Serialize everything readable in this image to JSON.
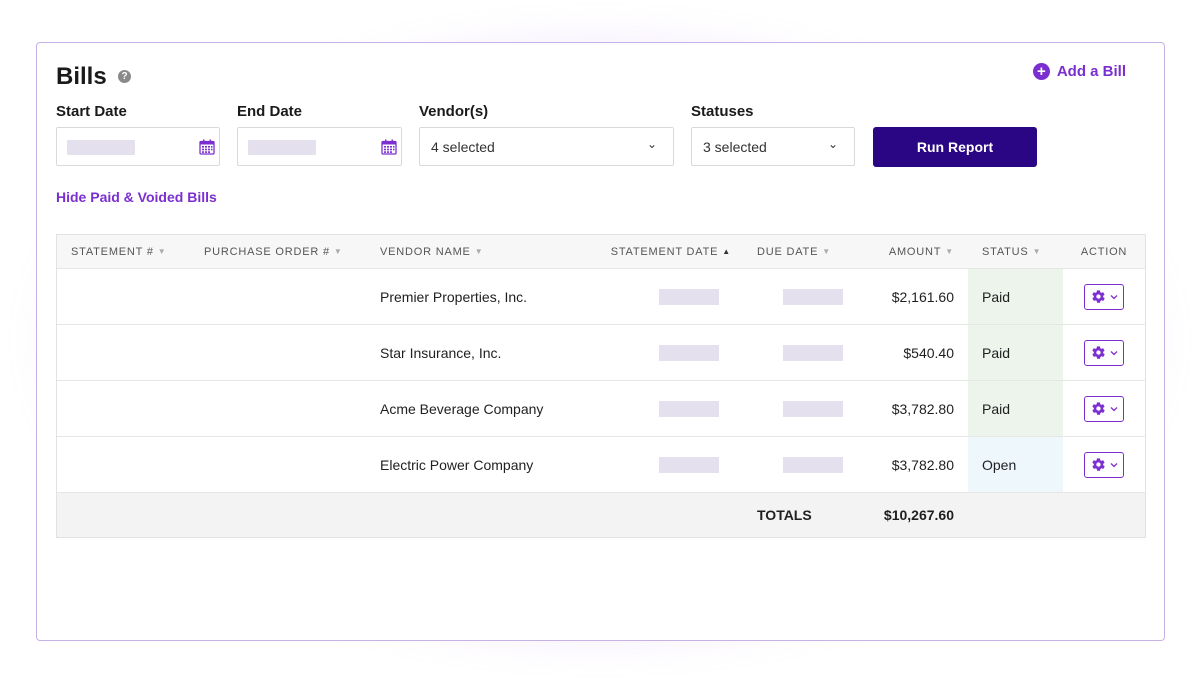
{
  "page": {
    "title": "Bills",
    "help_icon": "?",
    "add_bill_label": "Add a Bill",
    "accent_color": "#7b2fd0",
    "primary_button_color": "#2a0685"
  },
  "filters": {
    "start_date_label": "Start Date",
    "end_date_label": "End Date",
    "vendors_label": "Vendor(s)",
    "vendors_value": "4 selected",
    "statuses_label": "Statuses",
    "statuses_value": "3 selected",
    "run_report_label": "Run Report",
    "caret": "⌄"
  },
  "hide_link": "Hide Paid & Voided Bills",
  "table": {
    "headers": {
      "statement": "STATEMENT #",
      "purchase_order": "PURCHASE ORDER #",
      "vendor": "VENDOR NAME",
      "statement_date": "STATEMENT DATE",
      "due_date": "DUE DATE",
      "amount": "AMOUNT",
      "status": "STATUS",
      "action": "ACTION"
    },
    "sort_down": "▼",
    "sort_up": "▲",
    "rows": [
      {
        "vendor": "Premier Properties, Inc.",
        "amount": "$2,161.60",
        "status": "Paid"
      },
      {
        "vendor": "Star Insurance, Inc.",
        "amount": "$540.40",
        "status": "Paid"
      },
      {
        "vendor": "Acme Beverage Company",
        "amount": "$3,782.80",
        "status": "Paid"
      },
      {
        "vendor": "Electric Power Company",
        "amount": "$3,782.80",
        "status": "Open"
      }
    ],
    "totals_label": "TOTALS",
    "totals_amount": "$10,267.60"
  }
}
